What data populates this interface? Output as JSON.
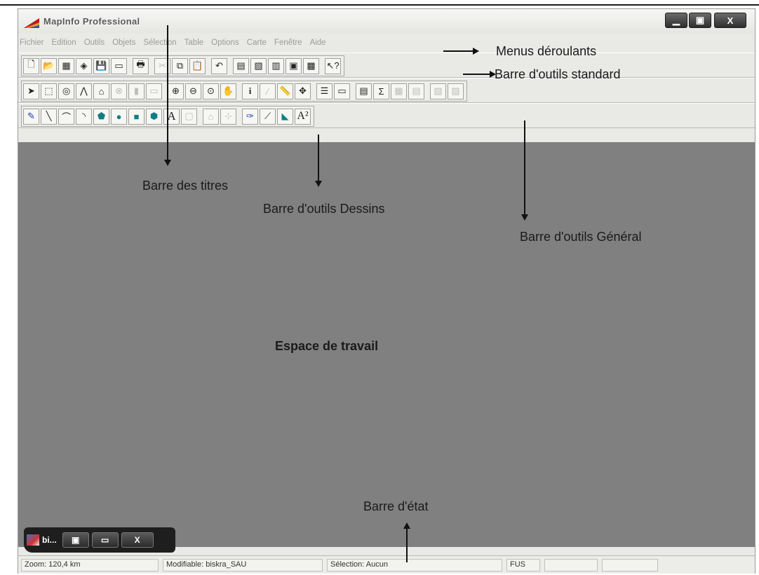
{
  "window": {
    "title": "MapInfo Professional",
    "controls": {
      "minimize": "▁",
      "maximize": "▣",
      "close": "X"
    }
  },
  "menu": [
    "Fichier",
    "Edition",
    "Outils",
    "Objets",
    "Sélection",
    "Table",
    "Options",
    "Carte",
    "Fenêtre",
    "Aide"
  ],
  "annotations": {
    "menus": "Menus déroulants",
    "standard": "Barre d'outils standard",
    "titles": "Barre des titres",
    "dessins": "Barre d'outils Dessins",
    "general": "Barre d'outils Général",
    "workspace": "Espace de  travail",
    "status": "Barre d'état"
  },
  "toolbar_standard": [
    "new-icon",
    "open-icon",
    "open-workspace-icon",
    "open-dbms-icon",
    "save-icon",
    "close-table-icon",
    "print-icon",
    "cut-icon",
    "copy-icon",
    "paste-icon",
    "undo-icon",
    "new-browser-icon",
    "new-mapper-icon",
    "new-grapher-icon",
    "new-layout-icon",
    "redistrict-icon",
    "help-icon"
  ],
  "toolbar_main": [
    "select-icon",
    "marquee-select-icon",
    "radius-select-icon",
    "polygon-select-icon",
    "boundary-select-icon",
    "unselect-icon",
    "graph-select-icon",
    "invert-select-icon",
    "zoom-in-icon",
    "zoom-out-icon",
    "change-view-icon",
    "grabber-icon",
    "info-icon",
    "label-icon",
    "ruler-icon",
    "drag-window-icon",
    "layer-control-icon",
    "legend-icon",
    "statistics-icon",
    "sum-icon",
    "create-thematic-icon",
    "hotlink-icon",
    "show-legend-icon",
    "move-legend-icon"
  ],
  "toolbar_drawing": [
    "symbol-icon",
    "line-icon",
    "polyline-icon",
    "arc-icon",
    "polygon-icon",
    "ellipse-icon",
    "rectangle-icon",
    "rounded-rectangle-icon",
    "text-icon",
    "frame-icon",
    "reshape-icon",
    "add-node-icon",
    "symbol-style-icon",
    "line-style-icon",
    "region-style-icon",
    "text-style-icon"
  ],
  "mini_window": {
    "label": "bi...",
    "restore": "▣",
    "maximize": "▭",
    "close": "X"
  },
  "status": {
    "zoom": "Zoom: 120,4 km",
    "editable": "Modifiable: biskra_SAU",
    "selection": "Sélection: Aucun",
    "mode": "FUS"
  }
}
